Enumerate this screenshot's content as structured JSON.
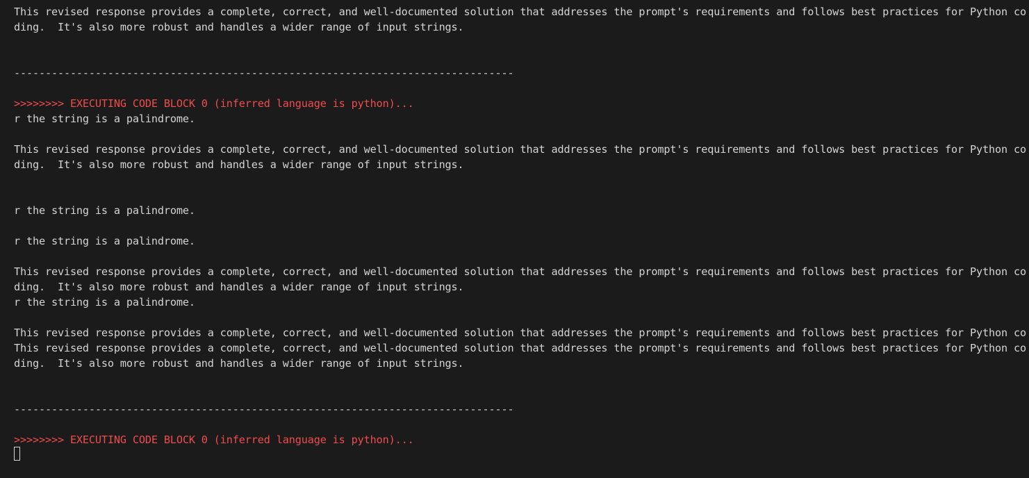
{
  "terminal": {
    "cursor": "cursor-block",
    "colors": {
      "background": "#1b1b1b",
      "text": "#d4d4d4",
      "exec_header": "#f14c4c"
    },
    "lines": [
      {
        "kind": "text",
        "text": "This revised response provides a complete, correct, and well-documented solution that addresses the prompt's requirements and follows best practices for Python co"
      },
      {
        "kind": "text",
        "text": "ding.  It's also more robust and handles a wider range of input strings."
      },
      {
        "kind": "blank",
        "text": ""
      },
      {
        "kind": "blank",
        "text": ""
      },
      {
        "kind": "sep",
        "text": "--------------------------------------------------------------------------------"
      },
      {
        "kind": "blank",
        "text": ""
      },
      {
        "kind": "exec",
        "text": ">>>>>>>> EXECUTING CODE BLOCK 0 (inferred language is python)..."
      },
      {
        "kind": "text",
        "text": "r the string is a palindrome."
      },
      {
        "kind": "blank",
        "text": ""
      },
      {
        "kind": "text",
        "text": "This revised response provides a complete, correct, and well-documented solution that addresses the prompt's requirements and follows best practices for Python co"
      },
      {
        "kind": "text",
        "text": "ding.  It's also more robust and handles a wider range of input strings."
      },
      {
        "kind": "blank",
        "text": ""
      },
      {
        "kind": "blank",
        "text": ""
      },
      {
        "kind": "text",
        "text": "r the string is a palindrome."
      },
      {
        "kind": "blank",
        "text": ""
      },
      {
        "kind": "text",
        "text": "r the string is a palindrome."
      },
      {
        "kind": "blank",
        "text": ""
      },
      {
        "kind": "text",
        "text": "This revised response provides a complete, correct, and well-documented solution that addresses the prompt's requirements and follows best practices for Python co"
      },
      {
        "kind": "text",
        "text": "ding.  It's also more robust and handles a wider range of input strings."
      },
      {
        "kind": "text",
        "text": "r the string is a palindrome."
      },
      {
        "kind": "blank",
        "text": ""
      },
      {
        "kind": "text",
        "text": "This revised response provides a complete, correct, and well-documented solution that addresses the prompt's requirements and follows best practices for Python co"
      },
      {
        "kind": "text",
        "text": "This revised response provides a complete, correct, and well-documented solution that addresses the prompt's requirements and follows best practices for Python co"
      },
      {
        "kind": "text",
        "text": "ding.  It's also more robust and handles a wider range of input strings."
      },
      {
        "kind": "blank",
        "text": ""
      },
      {
        "kind": "blank",
        "text": ""
      },
      {
        "kind": "sep",
        "text": "--------------------------------------------------------------------------------"
      },
      {
        "kind": "blank",
        "text": ""
      },
      {
        "kind": "exec",
        "text": ">>>>>>>> EXECUTING CODE BLOCK 0 (inferred language is python)..."
      }
    ]
  }
}
